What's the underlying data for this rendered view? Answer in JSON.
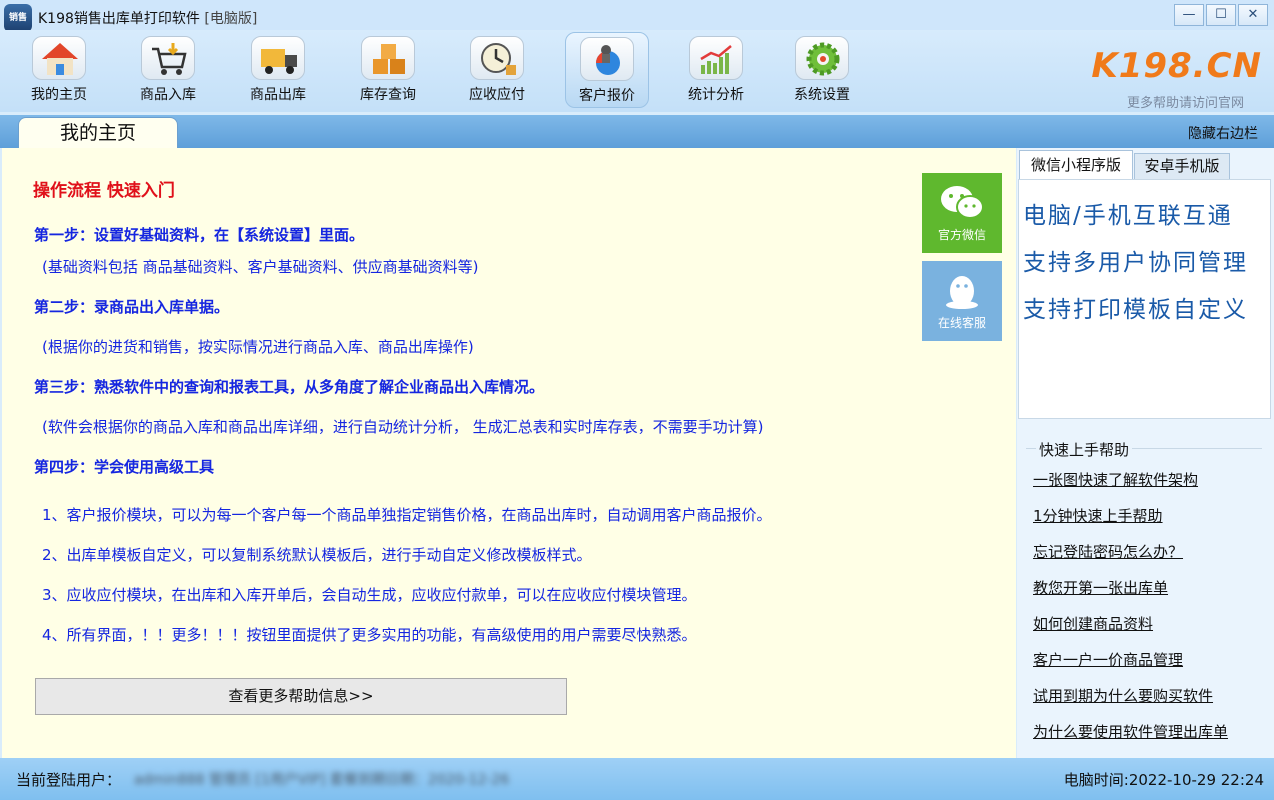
{
  "window": {
    "icon_text": "销售",
    "title": "K198销售出库单打印软件",
    "edition": "[电脑版]",
    "min": "—",
    "max": "☐",
    "close": "✕"
  },
  "toolbar": {
    "items": [
      {
        "label": "我的主页",
        "icon": "house-icon"
      },
      {
        "label": "商品入库",
        "icon": "cart-icon"
      },
      {
        "label": "商品出库",
        "icon": "truck-icon"
      },
      {
        "label": "库存查询",
        "icon": "boxes-icon"
      },
      {
        "label": "应收应付",
        "icon": "clock-icon"
      },
      {
        "label": "客户报价",
        "icon": "customer-quote-icon"
      },
      {
        "label": "统计分析",
        "icon": "chart-icon"
      },
      {
        "label": "系统设置",
        "icon": "gear-icon"
      }
    ],
    "active_index": 5
  },
  "logo": {
    "main": "K198",
    "suffix": ".CN",
    "sub": "更多帮助请访问官网"
  },
  "tabbar": {
    "home_tab": "我的主页",
    "hide_sidebar": "隐藏右边栏"
  },
  "main": {
    "heading": "操作流程 快速入门",
    "step1": "第一步：设置好基础资料，在【系统设置】里面。",
    "note1": "(基础资料包括 商品基础资料、客户基础资料、供应商基础资料等)",
    "step2": "第二步：录商品出入库单据。",
    "note2": "(根据你的进货和销售，按实际情况进行商品入库、商品出库操作)",
    "step3": "第三步：熟悉软件中的查询和报表工具，从多角度了解企业商品出入库情况。",
    "note3": "(软件会根据你的商品入库和商品出库详细，进行自动统计分析， 生成汇总表和实时库存表，不需要手功计算)",
    "step4": "第四步：学会使用高级工具",
    "items": [
      "1、客户报价模块，可以为每一个客户每一个商品单独指定销售价格，在商品出库时，自动调用客户商品报价。",
      "2、出库单模板自定义，可以复制系统默认模板后，进行手动自定义修改模板样式。",
      "3、应收应付模块，在出库和入库开单后，会自动生成，应收应付款单，可以在应收应付模块管理。",
      "4、所有界面，！！更多！！！按钮里面提供了更多实用的功能，有高级使用的用户需要尽快熟悉。"
    ],
    "more_button": "查看更多帮助信息>>",
    "wechat_label": "官方微信",
    "service_label": "在线客服"
  },
  "sidebar": {
    "tabs": [
      "微信小程序版",
      "安卓手机版"
    ],
    "promo": [
      "电脑/手机互联互通",
      "支持多用户协同管理",
      "支持打印模板自定义"
    ],
    "help_title": "快速上手帮助",
    "help_links": [
      "一张图快速了解软件架构",
      "1分钟快速上手帮助",
      "忘记登陆密码怎么办？",
      "教您开第一张出库单",
      "如何创建商品资料",
      "客户一户一价商品管理",
      "试用到期为什么要购买软件",
      "为什么要使用软件管理出库单"
    ]
  },
  "status": {
    "user_label": "当前登陆用户：",
    "user_value": "admin888 管理员 [1用户VIP] 套餐到期日期：2020-12-26",
    "time_text": "电脑时间:2022-10-29 22:24"
  }
}
